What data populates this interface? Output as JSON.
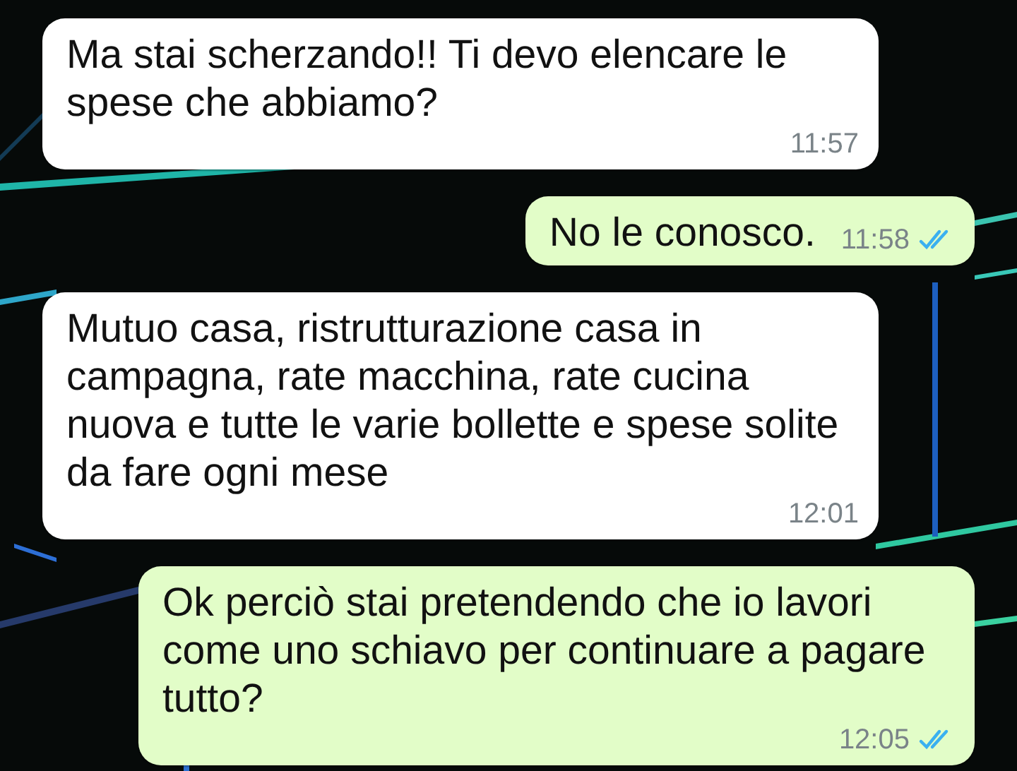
{
  "messages": [
    {
      "kind": "incoming",
      "text": "Ma stai scherzando!! Ti devo elencare le spese che abbiamo?",
      "time": "11:57"
    },
    {
      "kind": "outgoing",
      "text": "No le conosco.",
      "time": "11:58",
      "read": true
    },
    {
      "kind": "incoming",
      "text": "Mutuo casa, ristrutturazione casa in campagna, rate macchina, rate cucina nuova e tutte le varie bollette e spese solite da fare ogni mese",
      "time": "12:01"
    },
    {
      "kind": "outgoing",
      "text": "Ok perciò stai pretendendo che io lavori come uno schiavo per continuare a pagare tutto?",
      "time": "12:05",
      "read": true
    }
  ]
}
